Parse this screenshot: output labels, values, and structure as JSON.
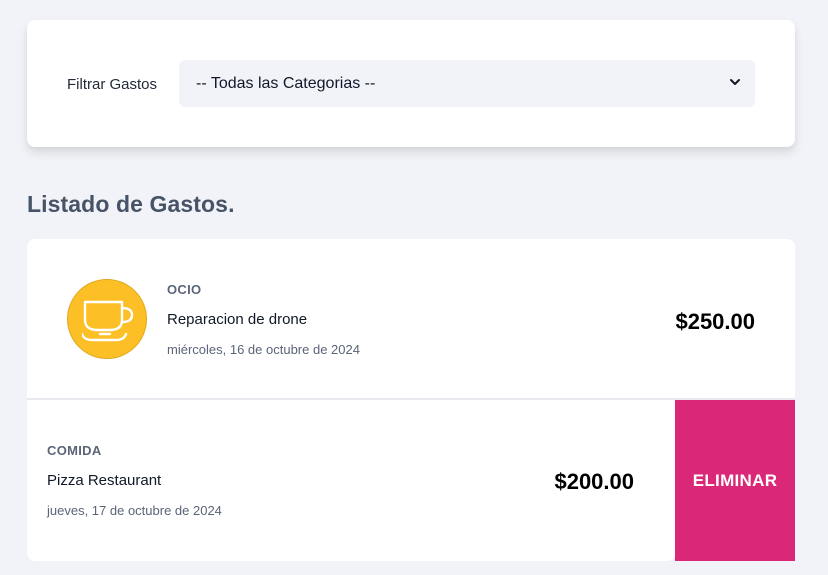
{
  "filter": {
    "label": "Filtrar Gastos",
    "selected": "-- Todas las Categorias --"
  },
  "list": {
    "title": "Listado de Gastos."
  },
  "expenses": [
    {
      "category": "OCIO",
      "name": "Reparacion de drone",
      "date": "miércoles, 16 de octubre de 2024",
      "amount": "$250.00",
      "icon": "cup-icon",
      "icon_color": "#fcbf25"
    },
    {
      "category": "COMIDA",
      "name": "Pizza Restaurant",
      "date": "jueves, 17 de octubre de 2024",
      "amount": "$200.00",
      "action": "ELIMINAR",
      "action_color": "#db2777"
    }
  ]
}
